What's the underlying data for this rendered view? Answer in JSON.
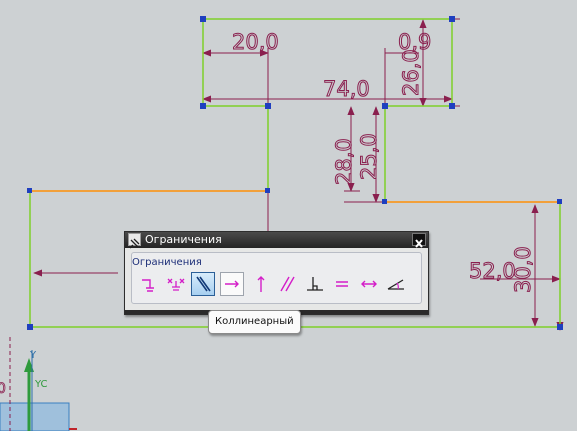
{
  "sketch": {
    "dimensions": {
      "top_width": "20,0",
      "top_offset": "0,9",
      "top_total": "74,0",
      "right_height": "26,0",
      "stem_height1": "28,0",
      "stem_height2": "25,0",
      "base_height": "30,0",
      "right_width": "52,0"
    },
    "axis_y": "Y",
    "axis_yc": "YC",
    "colors": {
      "background": "#cdd1d3",
      "geometry": "#7fcf2a",
      "selected": "#f2a03a",
      "dimension": "#8a1f4e",
      "vertex": "#1f3fbf"
    }
  },
  "dialog": {
    "title": "Ограничения",
    "group_label": "Ограничения",
    "tools": [
      {
        "name": "fixed-icon",
        "state": "normal"
      },
      {
        "name": "fully-fixed-icon",
        "state": "normal"
      },
      {
        "name": "collinear-icon",
        "state": "active"
      },
      {
        "name": "horizontal-icon",
        "state": "pressed"
      },
      {
        "name": "vertical-icon",
        "state": "normal"
      },
      {
        "name": "parallel-icon",
        "state": "normal"
      },
      {
        "name": "perpendicular-icon",
        "state": "normal"
      },
      {
        "name": "equal-length-icon",
        "state": "normal"
      },
      {
        "name": "constant-length-icon",
        "state": "normal"
      },
      {
        "name": "constant-angle-icon",
        "state": "normal"
      }
    ]
  },
  "tooltip": {
    "text": "Коллинеарный"
  }
}
